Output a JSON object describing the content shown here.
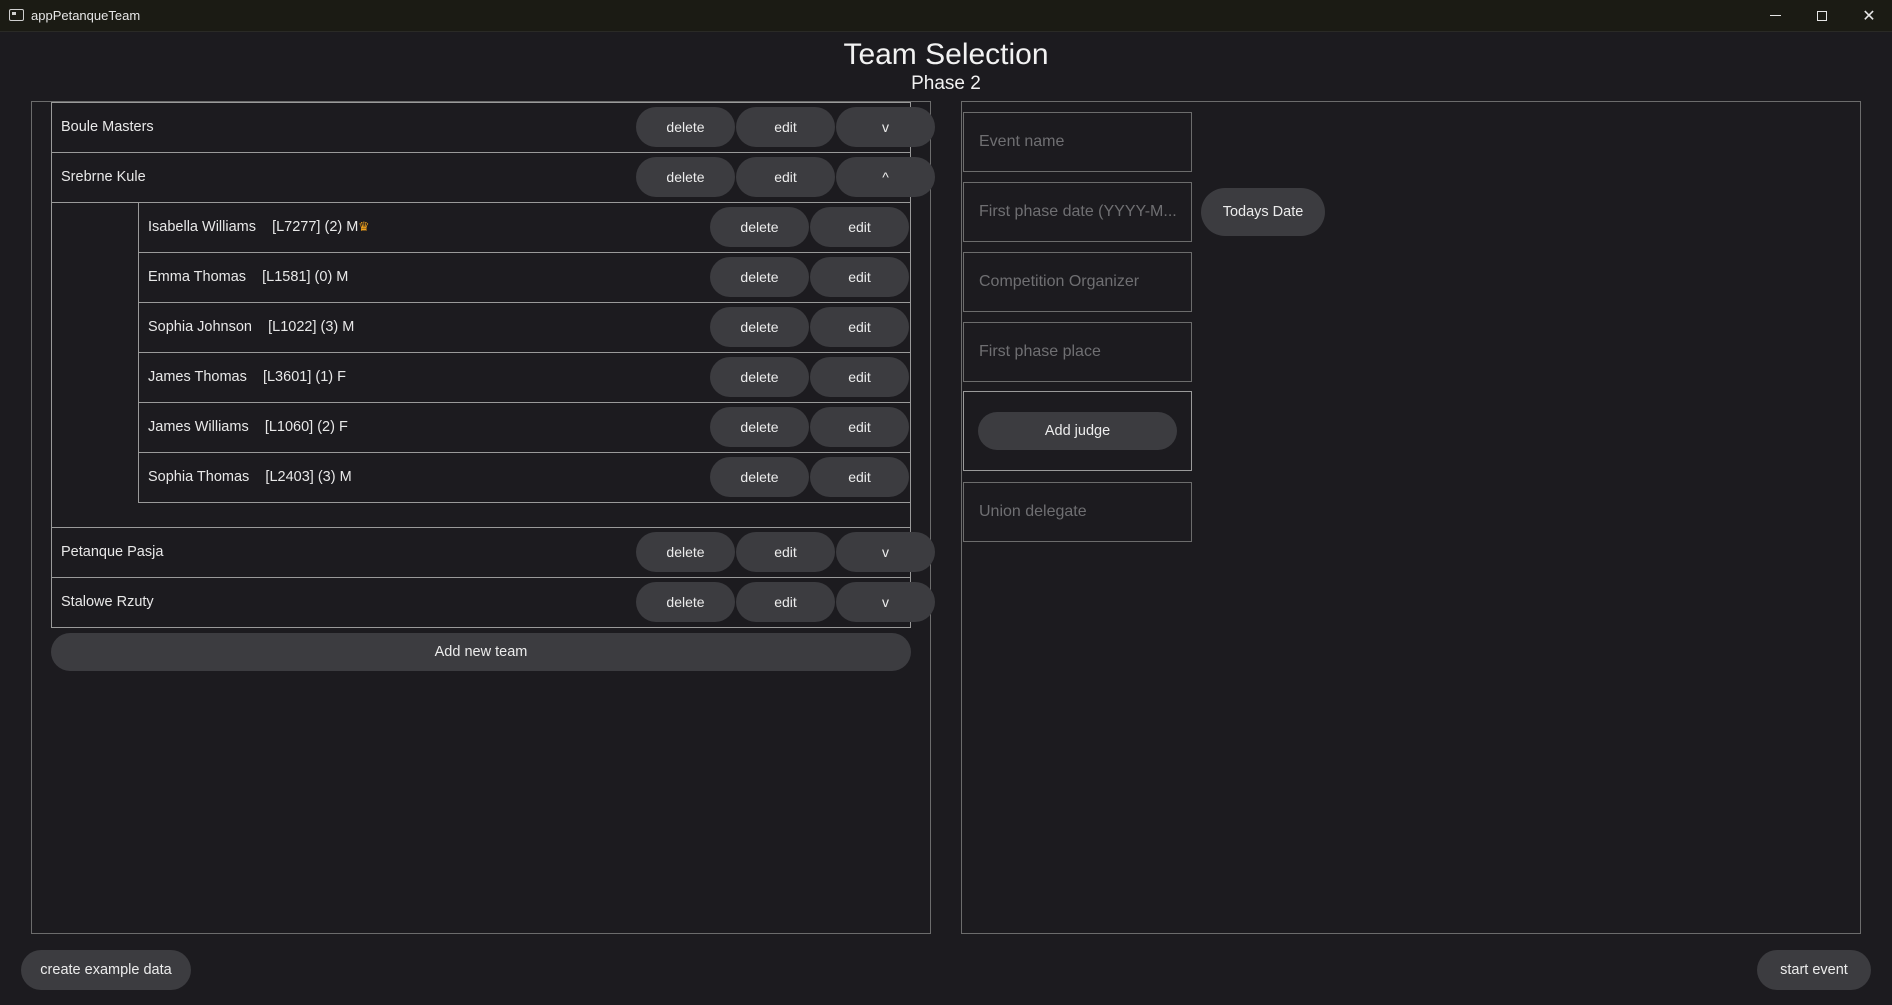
{
  "window": {
    "title": "appPetanqueTeam",
    "icons": {
      "app": "app-window-icon",
      "minimize": "minimize-icon",
      "maximize": "maximize-icon",
      "close": "close-icon"
    },
    "close_glyph": "✕"
  },
  "header": {
    "title": "Team Selection",
    "subtitle": "Phase 2"
  },
  "teams": [
    {
      "name": "Boule Masters",
      "delete_label": "delete",
      "edit_label": "edit",
      "toggle_label": "v",
      "expanded": false
    },
    {
      "name": "Srebrne Kule",
      "delete_label": "delete",
      "edit_label": "edit",
      "toggle_label": "^",
      "expanded": true,
      "players": [
        {
          "label": "Isabella Williams    [L7277] (2) M",
          "captain": true,
          "captain_icon": "crown-icon",
          "captain_glyph": "♛",
          "delete_label": "delete",
          "edit_label": "edit"
        },
        {
          "label": "Emma Thomas    [L1581] (0) M",
          "captain": false,
          "delete_label": "delete",
          "edit_label": "edit"
        },
        {
          "label": "Sophia Johnson    [L1022] (3) M",
          "captain": false,
          "delete_label": "delete",
          "edit_label": "edit"
        },
        {
          "label": "James Thomas    [L3601] (1) F",
          "captain": false,
          "delete_label": "delete",
          "edit_label": "edit"
        },
        {
          "label": "James Williams    [L1060] (2) F",
          "captain": false,
          "delete_label": "delete",
          "edit_label": "edit"
        },
        {
          "label": "Sophia Thomas    [L2403] (3) M",
          "captain": false,
          "delete_label": "delete",
          "edit_label": "edit"
        }
      ]
    },
    {
      "name": "Petanque Pasja",
      "delete_label": "delete",
      "edit_label": "edit",
      "toggle_label": "v",
      "expanded": false
    },
    {
      "name": "Stalowe Rzuty",
      "delete_label": "delete",
      "edit_label": "edit",
      "toggle_label": "v",
      "expanded": false
    }
  ],
  "add_team_label": "Add new team",
  "event_form": {
    "event_name": {
      "value": "",
      "placeholder": "Event name"
    },
    "first_phase_date": {
      "value": "",
      "placeholder": "First phase date (YYYY-M..."
    },
    "todays_date_label": "Todays Date",
    "organizer": {
      "value": "",
      "placeholder": "Competition Organizer"
    },
    "first_phase_place": {
      "value": "",
      "placeholder": "First phase place"
    },
    "add_judge_label": "Add judge",
    "union_delegate": {
      "value": "",
      "placeholder": "Union delegate"
    }
  },
  "footer": {
    "create_example_label": "create example data",
    "start_event_label": "start event"
  },
  "colors": {
    "background": "#1c1b1f",
    "button": "#3c3c40",
    "border": "#9a9a9a",
    "placeholder": "#6f6f72",
    "captain": "#f2a21b"
  }
}
